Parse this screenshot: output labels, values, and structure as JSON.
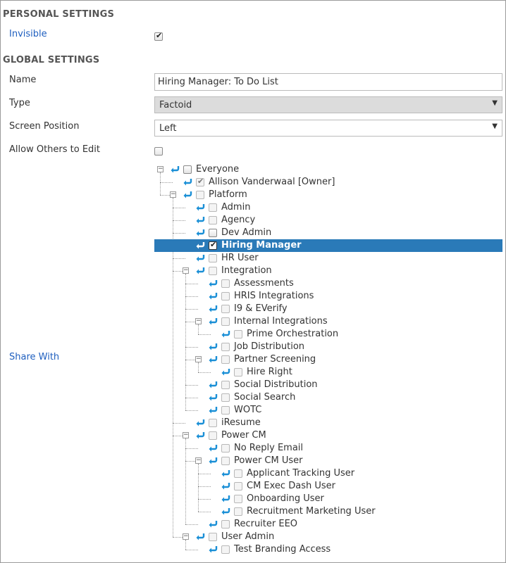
{
  "personal": {
    "title": "PERSONAL SETTINGS",
    "invisible_label": "Invisible",
    "invisible_checked": true
  },
  "global": {
    "title": "GLOBAL SETTINGS",
    "name_label": "Name",
    "name_value": "Hiring Manager: To Do List",
    "type_label": "Type",
    "type_value": "Factoid",
    "position_label": "Screen Position",
    "position_value": "Left",
    "allow_edit_label": "Allow Others to Edit",
    "allow_edit_checked": false,
    "share_label": "Share With"
  },
  "tree": [
    {
      "label": "Everyone",
      "depth": 0,
      "expand": "minus",
      "checked": false,
      "enabled": true
    },
    {
      "label": "Allison Vanderwaal [Owner]",
      "depth": 1,
      "expand": null,
      "checked": true,
      "enabled": false
    },
    {
      "label": "Platform",
      "depth": 1,
      "expand": "minus",
      "checked": false,
      "enabled": false
    },
    {
      "label": "Admin",
      "depth": 2,
      "expand": null,
      "checked": false,
      "enabled": false
    },
    {
      "label": "Agency",
      "depth": 2,
      "expand": null,
      "checked": false,
      "enabled": false
    },
    {
      "label": "Dev Admin",
      "depth": 2,
      "expand": null,
      "checked": false,
      "enabled": true
    },
    {
      "label": "Hiring Manager",
      "depth": 2,
      "expand": null,
      "checked": true,
      "enabled": true,
      "selected": true
    },
    {
      "label": "HR User",
      "depth": 2,
      "expand": null,
      "checked": false,
      "enabled": false
    },
    {
      "label": "Integration",
      "depth": 2,
      "expand": "minus",
      "checked": false,
      "enabled": false
    },
    {
      "label": "Assessments",
      "depth": 3,
      "expand": null,
      "checked": false,
      "enabled": false
    },
    {
      "label": "HRIS Integrations",
      "depth": 3,
      "expand": null,
      "checked": false,
      "enabled": false
    },
    {
      "label": "I9 & EVerify",
      "depth": 3,
      "expand": null,
      "checked": false,
      "enabled": false
    },
    {
      "label": "Internal Integrations",
      "depth": 3,
      "expand": "minus",
      "checked": false,
      "enabled": false
    },
    {
      "label": "Prime Orchestration",
      "depth": 4,
      "expand": null,
      "checked": false,
      "enabled": false
    },
    {
      "label": "Job Distribution",
      "depth": 3,
      "expand": null,
      "checked": false,
      "enabled": false
    },
    {
      "label": "Partner Screening",
      "depth": 3,
      "expand": "minus",
      "checked": false,
      "enabled": false
    },
    {
      "label": "Hire Right",
      "depth": 4,
      "expand": null,
      "checked": false,
      "enabled": false
    },
    {
      "label": "Social Distribution",
      "depth": 3,
      "expand": null,
      "checked": false,
      "enabled": false
    },
    {
      "label": "Social Search",
      "depth": 3,
      "expand": null,
      "checked": false,
      "enabled": false
    },
    {
      "label": "WOTC",
      "depth": 3,
      "expand": null,
      "checked": false,
      "enabled": false
    },
    {
      "label": "iResume",
      "depth": 2,
      "expand": null,
      "checked": false,
      "enabled": false
    },
    {
      "label": "Power CM",
      "depth": 2,
      "expand": "minus",
      "checked": false,
      "enabled": false
    },
    {
      "label": "No Reply Email",
      "depth": 3,
      "expand": null,
      "checked": false,
      "enabled": false
    },
    {
      "label": "Power CM User",
      "depth": 3,
      "expand": "minus",
      "checked": false,
      "enabled": false
    },
    {
      "label": "Applicant Tracking User",
      "depth": 4,
      "expand": null,
      "checked": false,
      "enabled": false
    },
    {
      "label": "CM Exec Dash User",
      "depth": 4,
      "expand": null,
      "checked": false,
      "enabled": false
    },
    {
      "label": "Onboarding User",
      "depth": 4,
      "expand": null,
      "checked": false,
      "enabled": false
    },
    {
      "label": "Recruitment Marketing User",
      "depth": 4,
      "expand": null,
      "checked": false,
      "enabled": false
    },
    {
      "label": "Recruiter EEO",
      "depth": 3,
      "expand": null,
      "checked": false,
      "enabled": false
    },
    {
      "label": "User Admin",
      "depth": 2,
      "expand": "minus",
      "checked": false,
      "enabled": false
    },
    {
      "label": "Test Branding Access",
      "depth": 3,
      "expand": null,
      "checked": false,
      "enabled": false
    }
  ],
  "colors": {
    "selected_row": "#2a7ab8",
    "link_blue": "#1f5fbf",
    "share_icon": "#1a8fd6"
  }
}
